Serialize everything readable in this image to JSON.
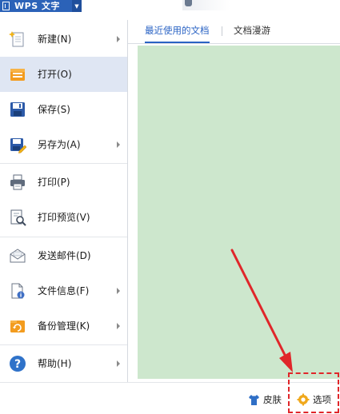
{
  "titlebar": {
    "app_title": "WPS 文字",
    "brand_color": "#2b62b8"
  },
  "menu": {
    "items": [
      {
        "label": "新建(N)",
        "icon": "new-document-icon",
        "has_submenu": true,
        "active": false
      },
      {
        "label": "打开(O)",
        "icon": "open-folder-icon",
        "has_submenu": false,
        "active": true
      },
      {
        "label": "保存(S)",
        "icon": "save-disk-icon",
        "has_submenu": false,
        "active": false
      },
      {
        "label": "另存为(A)",
        "icon": "save-as-icon",
        "has_submenu": true,
        "active": false
      },
      {
        "label": "打印(P)",
        "icon": "printer-icon",
        "has_submenu": false,
        "active": false
      },
      {
        "label": "打印预览(V)",
        "icon": "print-preview-icon",
        "has_submenu": false,
        "active": false
      },
      {
        "label": "发送邮件(D)",
        "icon": "envelope-icon",
        "has_submenu": false,
        "active": false
      },
      {
        "label": "文件信息(F)",
        "icon": "file-info-icon",
        "has_submenu": true,
        "active": false
      },
      {
        "label": "备份管理(K)",
        "icon": "backup-icon",
        "has_submenu": true,
        "active": false
      },
      {
        "label": "帮助(H)",
        "icon": "help-icon",
        "has_submenu": true,
        "active": false
      }
    ],
    "active_color": "#dfe6f3"
  },
  "tabs": [
    {
      "label": "最近使用的文档",
      "active": true
    },
    {
      "label": "文档漫游",
      "active": false
    }
  ],
  "content": {
    "background_color": "#cde7cd"
  },
  "bottombar": {
    "skin_label": "皮肤",
    "options_label": "选项"
  },
  "annotation": {
    "color": "#e0262a"
  }
}
